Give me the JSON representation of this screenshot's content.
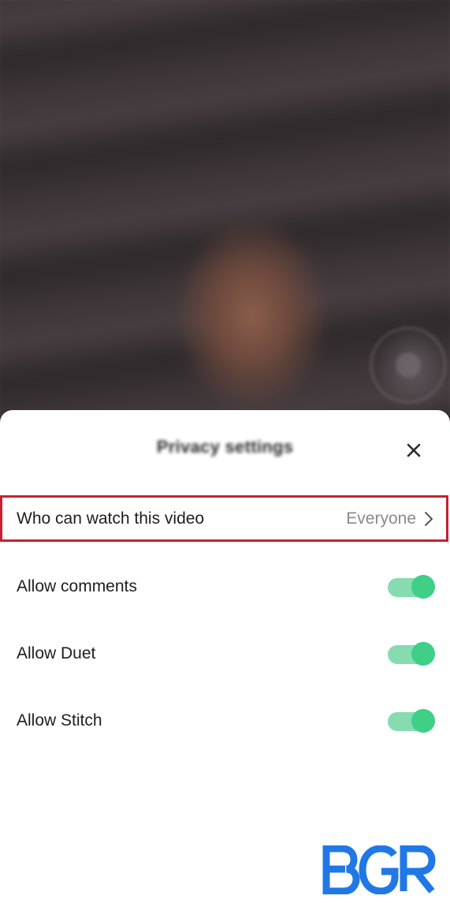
{
  "sheet": {
    "title": "Privacy settings"
  },
  "settings": {
    "who_can_watch": {
      "label": "Who can watch this video",
      "value": "Everyone"
    },
    "allow_comments": {
      "label": "Allow comments",
      "enabled": true
    },
    "allow_duet": {
      "label": "Allow Duet",
      "enabled": true
    },
    "allow_stitch": {
      "label": "Allow Stitch",
      "enabled": true
    }
  },
  "icons": {
    "close": "close-icon",
    "chevron": "chevron-right-icon"
  },
  "watermark": {
    "text": "BGR",
    "color": "#1f78e6"
  },
  "colors": {
    "highlight": "#c8202e",
    "toggle_on_knob": "#3fcf86",
    "toggle_on_track": "#86dcb0"
  }
}
